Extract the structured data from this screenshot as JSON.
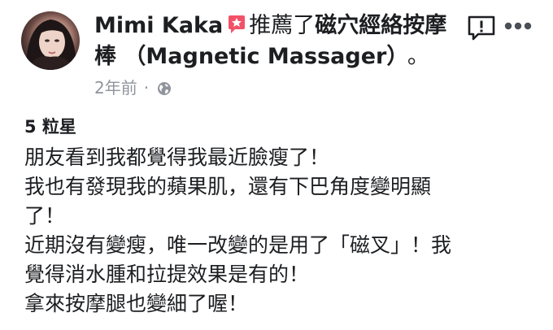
{
  "header": {
    "author_name": "Mimi Kaka",
    "verb": "推薦了",
    "page_name_part1": "磁穴經絡按摩",
    "page_name_part2": "棒 （Magnetic Massager）",
    "end_punct": "。"
  },
  "meta": {
    "time": "2年前",
    "separator": "·"
  },
  "review": {
    "rating": "5 粒星",
    "paragraphs": [
      "朋友看到我都覺得我最近臉瘦了！",
      "我也有發現我的蘋果肌，還有下巴角度變明顯\n了！",
      "近期沒有變瘦，唯一改變的是用了「磁叉」！我\n覺得消水腫和拉提效果是有的！",
      "拿來按摩腿也變細了喔！"
    ]
  },
  "icons": {
    "recommend": "recommend-badge-icon",
    "privacy": "globe-icon",
    "report": "report-icon",
    "more": "more-options-icon"
  },
  "colors": {
    "recommend_badge": "#f25268",
    "meta_text": "#90949c",
    "text": "#1c1e21"
  }
}
